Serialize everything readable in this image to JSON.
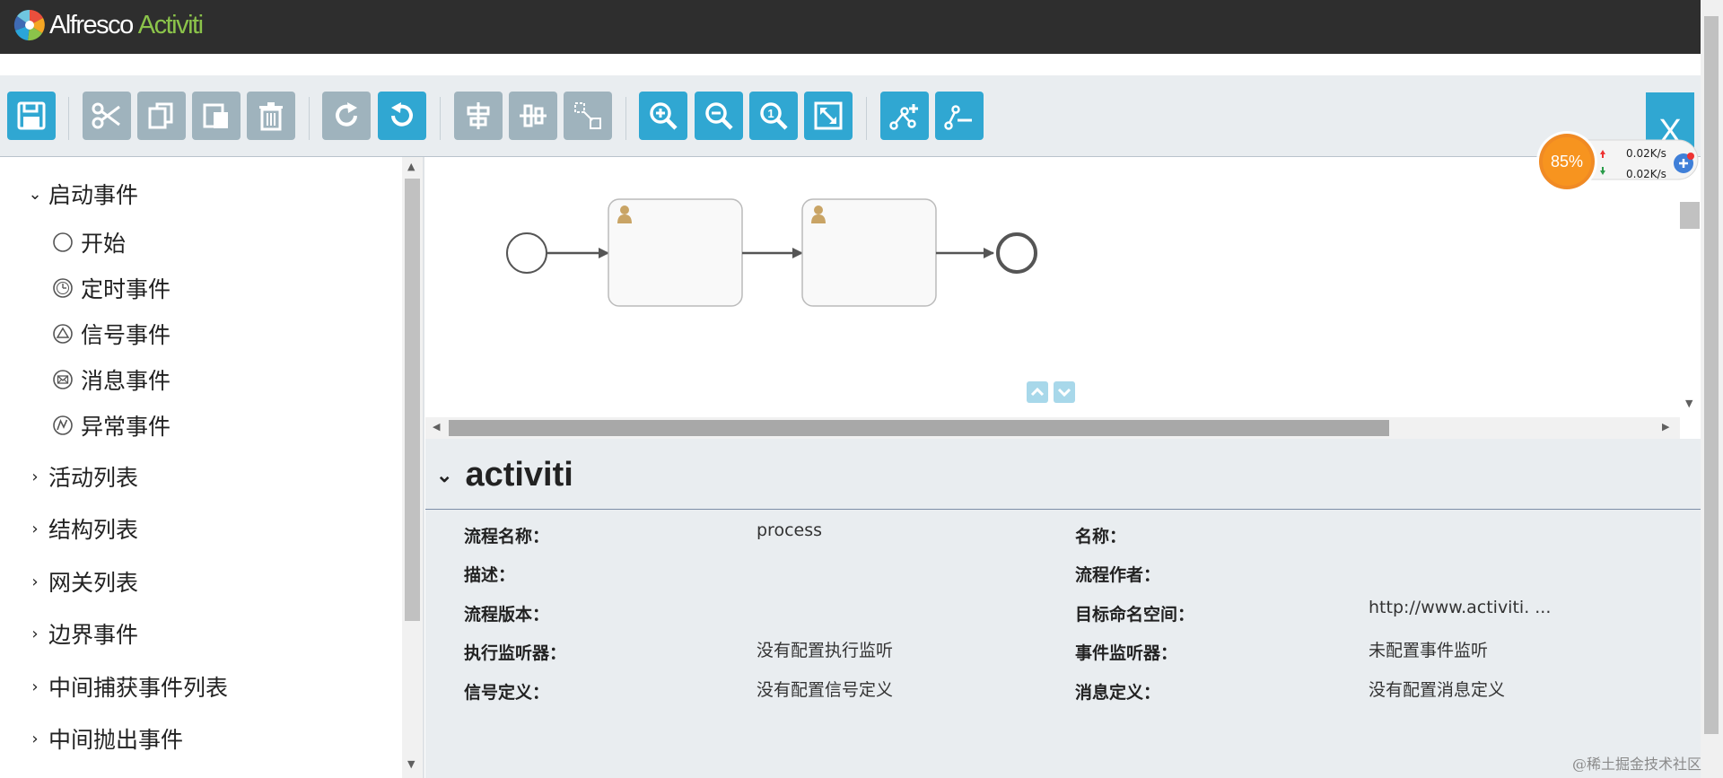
{
  "header": {
    "logo_part1": "Alfresco",
    "logo_part2": "Activiti"
  },
  "toolbar": {
    "buttons": [
      "save-icon",
      "cut-icon",
      "copy-icon",
      "paste-icon",
      "delete-icon",
      "redo-icon",
      "undo-icon",
      "align-horizontal-icon",
      "align-vertical-icon",
      "same-size-icon",
      "zoom-in-icon",
      "zoom-out-icon",
      "zoom-actual-icon",
      "zoom-fit-icon",
      "add-bendpoint-icon",
      "remove-bendpoint-icon"
    ],
    "close_label": "X"
  },
  "palette": {
    "start_events": {
      "label": "启动事件",
      "items": [
        {
          "label": "开始",
          "icon": "circle-icon"
        },
        {
          "label": "定时事件",
          "icon": "timer-icon"
        },
        {
          "label": "信号事件",
          "icon": "signal-icon"
        },
        {
          "label": "消息事件",
          "icon": "message-icon"
        },
        {
          "label": "异常事件",
          "icon": "error-icon"
        }
      ]
    },
    "categories": [
      "活动列表",
      "结构列表",
      "网关列表",
      "边界事件",
      "中间捕获事件列表",
      "中间抛出事件"
    ]
  },
  "properties": {
    "title": "activiti",
    "left": [
      {
        "label": "流程名称：",
        "value": "process"
      },
      {
        "label": "描述：",
        "value": ""
      },
      {
        "label": "流程版本：",
        "value": ""
      },
      {
        "label": "执行监听器：",
        "value": "没有配置执行监听"
      },
      {
        "label": "信号定义：",
        "value": "没有配置信号定义"
      }
    ],
    "right": [
      {
        "label": "名称：",
        "value": ""
      },
      {
        "label": "流程作者：",
        "value": ""
      },
      {
        "label": "目标命名空间：",
        "value": "http://www.activiti. ..."
      },
      {
        "label": "事件监听器：",
        "value": "未配置事件监听"
      },
      {
        "label": "消息定义：",
        "value": "没有配置消息定义"
      }
    ]
  },
  "net_widget": {
    "percent": "85%",
    "up": "0.02K/s",
    "down": "0.02K/s"
  },
  "watermark": "@稀土掘金技术社区",
  "colors": {
    "accent": "#30a7d2",
    "disabled": "#9fb3bd",
    "topbar": "#2e2e2e",
    "panel": "#e9edf0"
  }
}
